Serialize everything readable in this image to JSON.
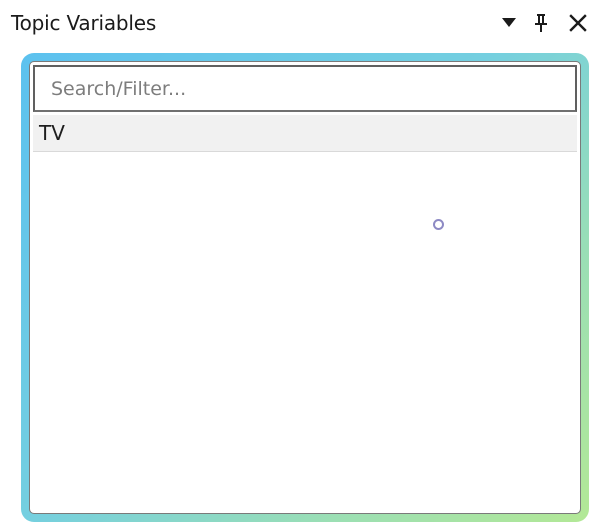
{
  "panel": {
    "title": "Topic Variables",
    "buttons": {
      "menu_icon": "triangle-down-icon",
      "pin_icon": "pin-icon",
      "close_icon": "close-icon"
    }
  },
  "search": {
    "value": "",
    "placeholder": "Search/Filter..."
  },
  "list": {
    "items": [
      {
        "label": "TV"
      }
    ]
  },
  "colors": {
    "frame_gradient_start": "#5cc1ef",
    "frame_gradient_end": "#b3e896",
    "selected_row_bg": "#f1f1f1",
    "cursor_ring": "#8d8ac4"
  }
}
